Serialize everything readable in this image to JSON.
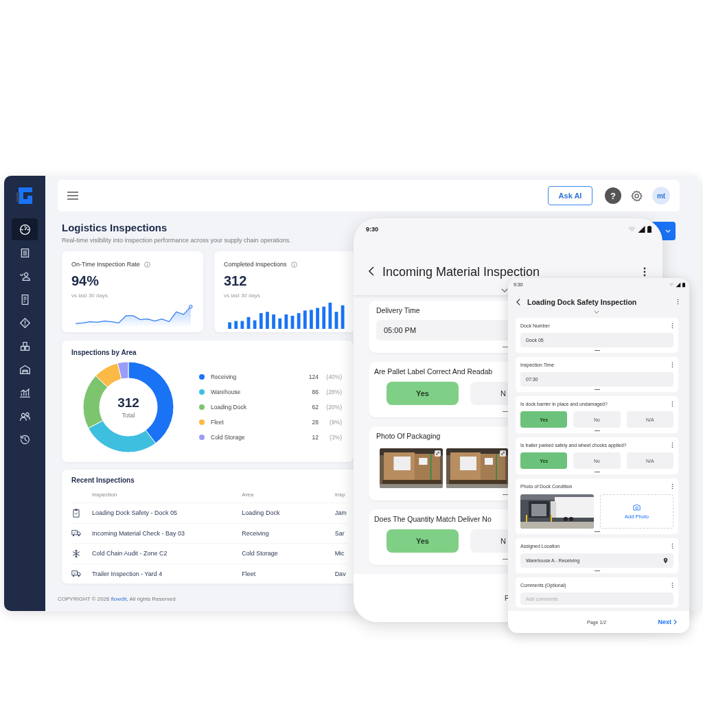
{
  "dashboard": {
    "sidebar": {
      "items": [
        {
          "selected": true
        },
        {
          "selected": false
        },
        {
          "selected": false
        },
        {
          "selected": false
        },
        {
          "selected": false
        },
        {
          "selected": false
        },
        {
          "selected": false
        },
        {
          "selected": false
        },
        {
          "selected": false
        },
        {
          "selected": false
        }
      ]
    },
    "header": {
      "ask_ai": "Ask AI",
      "help": "?",
      "avatar": "mt"
    },
    "title": "Logistics Inspections",
    "subtitle": "Real-time visibility into inspection performance across your supply chain operations.",
    "kpis": [
      {
        "kind": "line",
        "label": "On-Time Inspection Rate",
        "value": "94%",
        "caption": "vs last 30 days"
      },
      {
        "kind": "bars",
        "label": "Completed Inspections",
        "value": "312",
        "caption": "vs last 30 days"
      }
    ],
    "area_card": {
      "title": "Inspections by Area",
      "total": "312",
      "total_label": "Total",
      "legend": [
        {
          "label": "Receiving",
          "count": "124",
          "percent": "(40%)",
          "color": "#1a73f5"
        },
        {
          "label": "Warehouse",
          "count": "86",
          "percent": "(28%)",
          "color": "#3ebfe0"
        },
        {
          "label": "Loading Dock",
          "count": "62",
          "percent": "(20%)",
          "color": "#7cc56e"
        },
        {
          "label": "Fleet",
          "count": "28",
          "percent": "(9%)",
          "color": "#fbb945"
        },
        {
          "label": "Cold Storage",
          "count": "12",
          "percent": "(3%)",
          "color": "#9a9cf7"
        }
      ]
    },
    "recent": {
      "title": "Recent Inspections",
      "columns": [
        "Inspection",
        "Area",
        "Insp"
      ],
      "rows": [
        {
          "kind": "clipboard",
          "inspection": "Loading Dock Safety - Dock 05",
          "area": "Loading Dock",
          "column_3": "Jam"
        },
        {
          "kind": "truck",
          "inspection": "Incoming Material Check - Bay 03",
          "area": "Receiving",
          "column_3": "Sar"
        },
        {
          "kind": "snowflake",
          "inspection": "Cold Chain Audit - Zone C2",
          "area": "Cold Storage",
          "column_3": "Mic"
        },
        {
          "kind": "truck",
          "inspection": "Trailer Inspection - Yard 4",
          "area": "Fleet",
          "column_3": "Dav"
        }
      ]
    },
    "footer": {
      "prefix": "COPYRIGHT © 2026 ",
      "link": "flowdit,",
      "suffix": " All rights Reserved"
    }
  },
  "phone_form": {
    "time": "9:30",
    "title": "Incoming Material Inspection",
    "cards": [
      {
        "kind": "field",
        "label": "Delivery Time",
        "value": "05:00 PM"
      },
      {
        "kind": "choice",
        "label": "Are Pallet Label Correct And Readab",
        "options": [
          {
            "label": "Yes",
            "selected": true
          },
          {
            "label": "N",
            "selected": false
          }
        ]
      },
      {
        "kind": "photos",
        "label": "Photo Of Packaging"
      },
      {
        "kind": "choice",
        "label": "Does The Quantity Match Deliver No",
        "options": [
          {
            "label": "Yes",
            "selected": true
          },
          {
            "label": "N",
            "selected": false
          }
        ]
      }
    ],
    "footer": "P"
  },
  "dock_form": {
    "time": "9:30",
    "title": "Loading Dock Safety Inspection",
    "cards": [
      {
        "kind": "field",
        "label": "Dock Number",
        "value": "Dock 05"
      },
      {
        "kind": "field",
        "label": "Inspection Time",
        "value": "07:30"
      },
      {
        "kind": "choice",
        "label": "Is dock barrier in place and undamaged?",
        "options": [
          {
            "label": "Yes",
            "selected": true
          },
          {
            "label": "No",
            "selected": false
          },
          {
            "label": "N/A",
            "selected": false
          }
        ]
      },
      {
        "kind": "choice",
        "label": "Is trailer parked safely and wheel chocks applied?",
        "options": [
          {
            "label": "Yes",
            "selected": true
          },
          {
            "label": "No",
            "selected": false
          },
          {
            "label": "N/A",
            "selected": false
          }
        ]
      },
      {
        "kind": "photos",
        "label": "Photo of Dock Condition",
        "add_label": "Add Photo"
      },
      {
        "kind": "location",
        "label": "Assigned Location",
        "value": "Warehouse A - Receiving"
      },
      {
        "kind": "comment",
        "label": "Comments (Optional)",
        "placeholder": "Add comments"
      }
    ],
    "page": "Page 1/2",
    "next": "Next"
  }
}
